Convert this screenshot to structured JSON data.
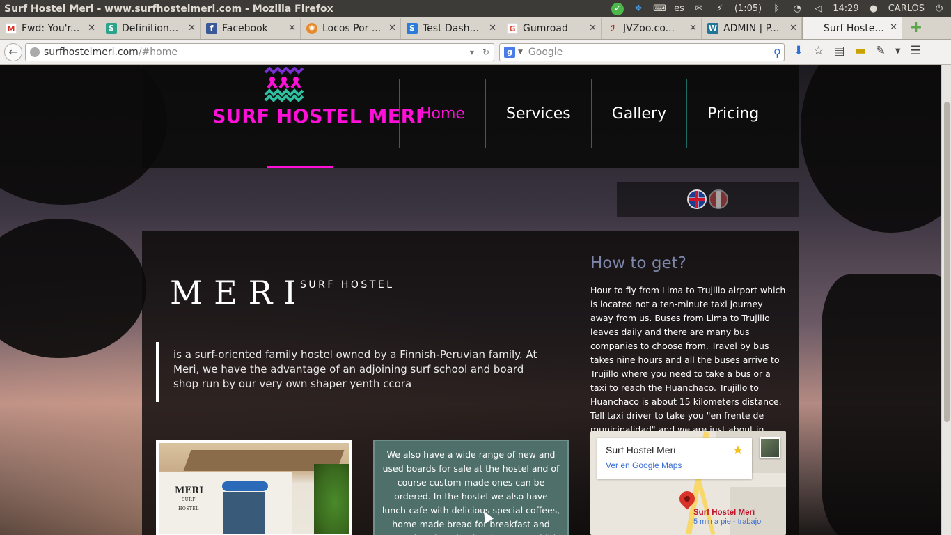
{
  "window": {
    "title": "Surf Hostel Meri - www.surfhostelmeri.com - Mozilla Firefox"
  },
  "tray": {
    "lang": "es",
    "battery": "(1:05)",
    "time": "14:29",
    "user": "CARLOS"
  },
  "tabs": [
    {
      "label": "Fwd: You'r...",
      "favicon": "gmail-icon",
      "fav_color": "#d93025",
      "fav_glyph": "M"
    },
    {
      "label": "Definition...",
      "favicon": "s-icon",
      "fav_color": "#2ba58a",
      "fav_glyph": "S"
    },
    {
      "label": "Facebook",
      "favicon": "facebook-icon",
      "fav_color": "#3b5998",
      "fav_glyph": "f"
    },
    {
      "label": "Locos Por ...",
      "favicon": "locos-icon",
      "fav_color": "#e58a2a",
      "fav_glyph": "✺"
    },
    {
      "label": "Test Dash...",
      "favicon": "s-blue-icon",
      "fav_color": "#2b7bd8",
      "fav_glyph": "S"
    },
    {
      "label": "Gumroad",
      "favicon": "gumroad-icon",
      "fav_color": "#e04a3a",
      "fav_glyph": "G"
    },
    {
      "label": "JVZoo.co...",
      "favicon": "jvzoo-icon",
      "fav_color": "#c82020",
      "fav_glyph": "ℐ"
    },
    {
      "label": "ADMIN | P...",
      "favicon": "wordpress-icon",
      "fav_color": "#21759b",
      "fav_glyph": "W"
    },
    {
      "label": "Surf Hoste...",
      "favicon": "",
      "fav_color": "",
      "fav_glyph": ""
    }
  ],
  "nav": {
    "url_host": "surfhostelmeri.com",
    "url_path": "/#home",
    "search_placeholder": "Google"
  },
  "site": {
    "logo_text": "SURF HOSTEL MERI",
    "menu": [
      "Home",
      "Services",
      "Gallery",
      "Pricing"
    ],
    "active_menu": "Home",
    "brand_main": "MERI",
    "brand_sub": "SURF HOSTEL",
    "intro": "is a surf-oriented family hostel owned by a Finnish-Peruvian family. At Meri, we have the advantage of an adjoining surf school and board shop run by our very own shaper yenth ccora",
    "card_text": "We also have a wide range of new and used boards for sale at the hostel and of course custom-made ones can be ordered. In the hostel we also have lunch-cafe with delicious special coffees, home made bread for breakfast and everyday changing lunch. We are child and",
    "photo_logo": "MERI",
    "photo_logo_sub": "SURF HOSTEL",
    "sidebar_title": "How to get?",
    "sidebar_text": "Hour to fly from Lima to Trujillo airport which is located not a ten-minute taxi journey away from us. Buses from Lima to Trujillo leaves daily and there are many bus companies to choose from. Travel by bus takes nine hours and all the buses arrive to Trujillo where you need to take a bus or a taxi to reach the Huanchaco. Trujillo to Huanchaco is about 15 kilometers distance. Tell taxi driver to take you \"en frente de municipalidad\" and we are just about in front of it.",
    "map_title": "Surf Hostel Meri",
    "map_link": "Ver en Google Maps",
    "map_place": "Surf Hostel Meri",
    "map_walk": "5 min a pie - trabajo"
  },
  "colors": {
    "brand_pink": "#ff10d8",
    "teal_line": "#1f6a62",
    "sidebar_title": "#7b86a8"
  }
}
